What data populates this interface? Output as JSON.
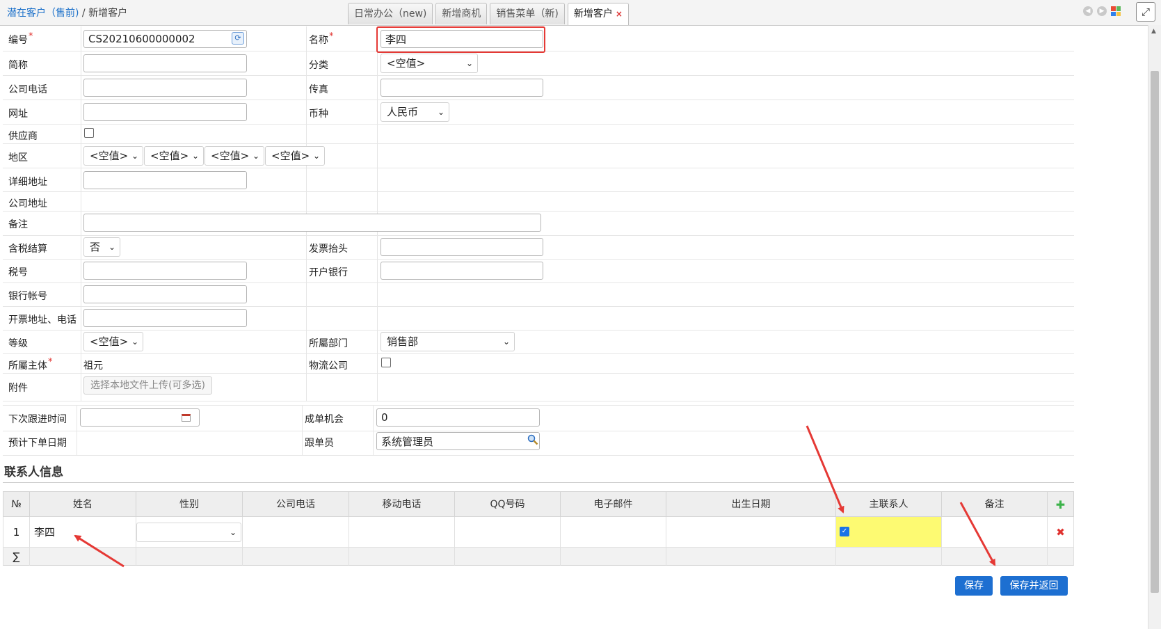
{
  "breadcrumb": {
    "parent": "潜在客户（售前)",
    "separator": "/",
    "current": "新增客户"
  },
  "tabs": [
    {
      "label": "日常办公（new)",
      "active": false,
      "closable": false
    },
    {
      "label": "新增商机",
      "active": false,
      "closable": false
    },
    {
      "label": "销售菜单（新)",
      "active": false,
      "closable": false
    },
    {
      "label": "新增客户",
      "active": true,
      "closable": true,
      "close_glyph": "×"
    }
  ],
  "toolbar_icons": [
    "back-icon",
    "forward-icon",
    "windows-icon",
    "expand-icon"
  ],
  "form": {
    "code": {
      "label": "编号",
      "required": "*",
      "value": "CS20210600000002"
    },
    "name": {
      "label": "名称",
      "required": "*",
      "value": "李四"
    },
    "short_name": {
      "label": "简称",
      "value": ""
    },
    "category": {
      "label": "分类",
      "value": "<空值>"
    },
    "company_phone": {
      "label": "公司电话",
      "value": ""
    },
    "fax": {
      "label": "传真",
      "value": ""
    },
    "website": {
      "label": "网址",
      "value": ""
    },
    "currency": {
      "label": "币种",
      "value": "人民币"
    },
    "supplier": {
      "label": "供应商",
      "checked": false
    },
    "region": {
      "label": "地区",
      "values": [
        "<空值>",
        "<空值>",
        "<空值>",
        "<空值>"
      ]
    },
    "detail_address": {
      "label": "详细地址",
      "value": ""
    },
    "company_address": {
      "label": "公司地址"
    },
    "remark": {
      "label": "备注",
      "value": ""
    },
    "tax_included": {
      "label": "含税结算",
      "value": "否"
    },
    "invoice_title": {
      "label": "发票抬头",
      "value": ""
    },
    "tax_no": {
      "label": "税号",
      "value": ""
    },
    "bank": {
      "label": "开户银行",
      "value": ""
    },
    "bank_account": {
      "label": "银行帐号",
      "value": ""
    },
    "invoice_address": {
      "label": "开票地址、电话",
      "value": ""
    },
    "level": {
      "label": "等级",
      "value": "<空值>"
    },
    "department": {
      "label": "所屬部门",
      "value": "销售部"
    },
    "owner_entity": {
      "label": "所屬主体",
      "required": "*",
      "value": "祖元"
    },
    "logistics": {
      "label": "物流公司",
      "checked": false
    },
    "attachment": {
      "label": "附件",
      "button": "选择本地文件上传(可多选)"
    },
    "next_followup": {
      "label": "下次跟进时间",
      "value": ""
    },
    "deal_chance": {
      "label": "成单机会",
      "value": "0"
    },
    "expected_order_date": {
      "label": "预计下单日期"
    },
    "follower": {
      "label": "跟单员",
      "value": "系统管理员"
    }
  },
  "contacts": {
    "section_title": "联系人信息",
    "columns": [
      "№",
      "姓名",
      "性别",
      "公司电话",
      "移动电话",
      "QQ号码",
      "电子邮件",
      "出生日期",
      "主联系人",
      "备注"
    ],
    "rows": [
      {
        "no": "1",
        "name": "李四",
        "gender": "",
        "company_phone": "",
        "mobile": "",
        "qq": "",
        "email": "",
        "birthday": "",
        "primary": true,
        "remark": ""
      }
    ],
    "sum_symbol": "∑",
    "add_glyph": "✚",
    "delete_glyph": "✖",
    "highlight_color": "#fdfa72"
  },
  "buttons": {
    "save": "保存",
    "save_and_return": "保存并返回"
  },
  "colors": {
    "accent": "#1d6fd1",
    "link": "#1a6fc9",
    "required": "#e0312e",
    "annotation": "#e53935"
  }
}
